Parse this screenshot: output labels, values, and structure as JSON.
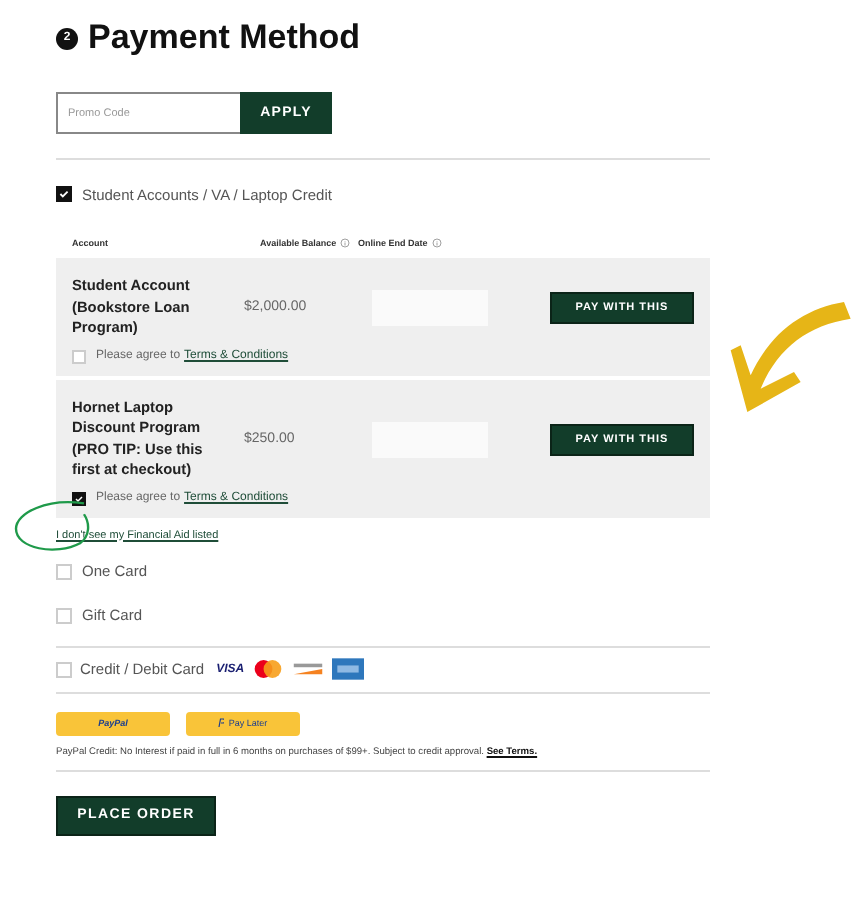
{
  "section": {
    "step": "2",
    "title": "Payment Method"
  },
  "promo": {
    "placeholder": "Promo Code",
    "button": "APPLY"
  },
  "student_accounts": {
    "label": "Student Accounts / VA / Laptop Credit",
    "checked": true,
    "columns": [
      {
        "label": "Account",
        "info": false
      },
      {
        "label": "Available Balance",
        "info": true
      },
      {
        "label": "Online End Date",
        "info": true
      }
    ],
    "rows": [
      {
        "account": "Student Account (Bookstore Loan Program)",
        "balance": "$2,000.00",
        "button": "PAY WITH THIS",
        "agree": "Please agree to",
        "terms": "Terms & Conditions",
        "checked": false
      },
      {
        "account": "Hornet Laptop Discount Program (PRO TIP: Use this first at checkout)",
        "balance": "$250.00",
        "button": "PAY WITH THIS",
        "agree": "Please agree to",
        "terms": "Terms & Conditions",
        "checked": true
      }
    ]
  },
  "financial_aid_link": "I don't see my Financial Aid listed",
  "options": [
    {
      "label": "One Card",
      "checked": false
    },
    {
      "label": "Gift Card",
      "checked": false
    }
  ],
  "credit_card": {
    "label": "Credit / Debit Card",
    "checked": false,
    "logos": [
      {
        "kind": "visa",
        "text": "VISA"
      },
      {
        "kind": "mastercard"
      },
      {
        "kind": "discover"
      },
      {
        "kind": "amex"
      }
    ]
  },
  "paypal": {
    "buttons": [
      {
        "kind": "paypal",
        "label": "PayPal"
      },
      {
        "kind": "paylater",
        "label": "Pay Later"
      }
    ],
    "note": "PayPal Credit: No Interest if paid in full in 6 months on purchases of $99+. Subject to credit approval.",
    "terms_link": "See Terms."
  },
  "place_order": "PLACE ORDER"
}
